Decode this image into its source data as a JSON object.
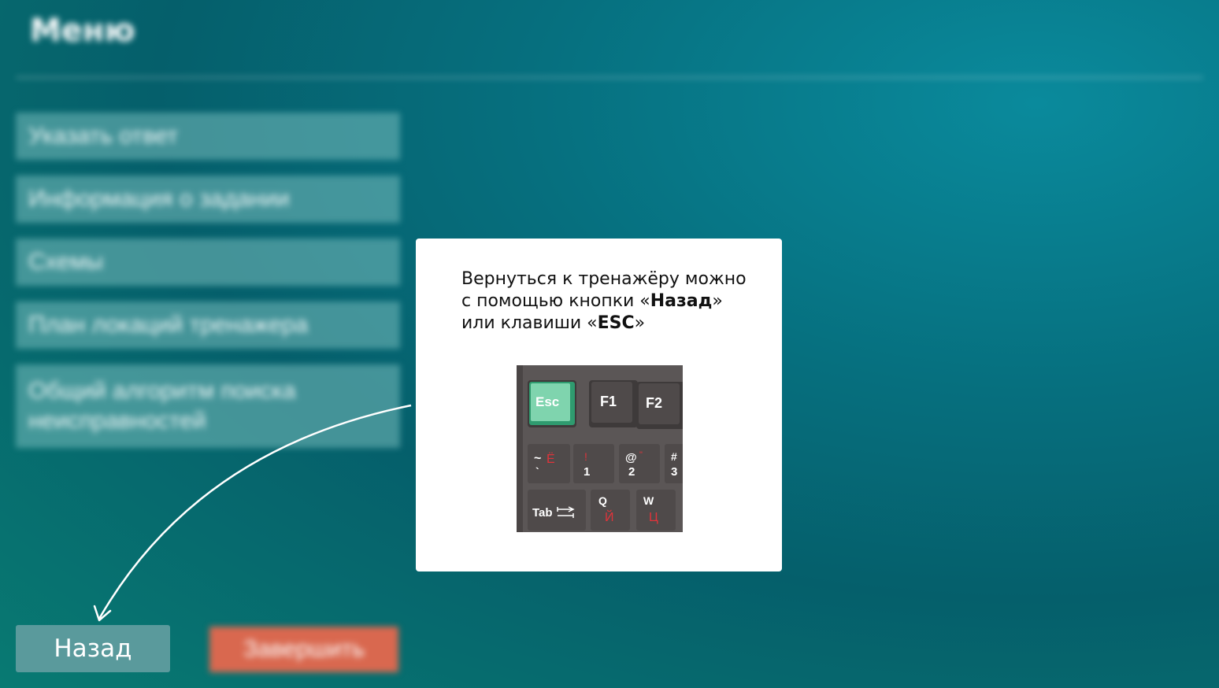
{
  "header": {
    "title": "Меню"
  },
  "menu": {
    "items": [
      {
        "label": "Указать ответ"
      },
      {
        "label": "Информация о задании"
      },
      {
        "label": "Схемы"
      },
      {
        "label": "План локаций тренажера"
      },
      {
        "label": "Общий алгоритм поиска неисправностей"
      }
    ]
  },
  "footer": {
    "back_label": "Назад",
    "finish_label": "Завершить"
  },
  "hint": {
    "line1": "Вернуться к тренажёру можно",
    "line2_prefix": "с помощью кнопки «",
    "line2_bold": "Назад",
    "line2_suffix": "»",
    "line3_prefix": "или клавиши «",
    "line3_bold": "ESC",
    "line3_suffix": "»"
  },
  "keyboard": {
    "esc": "Esc",
    "f1": "F1",
    "f2": "F2",
    "tilde_top": "~",
    "tilde_bottom": "`",
    "yo": "Ё",
    "excl": "!",
    "one": "1",
    "at": "@",
    "quote": "\"",
    "two": "2",
    "hash": "#",
    "three": "3",
    "tab": "Tab",
    "q": "Q",
    "y_cyr": "Й",
    "w": "W",
    "ts_cyr": "Ц"
  },
  "colors": {
    "background": "#066f7e",
    "menu_item": "#78bebe",
    "back_button": "#5a9a9c",
    "finish_button": "#d9684f",
    "esc_key": "#7fd4ae",
    "key_body": "#4a4545",
    "cyrillic_letters": "#e0333a"
  }
}
